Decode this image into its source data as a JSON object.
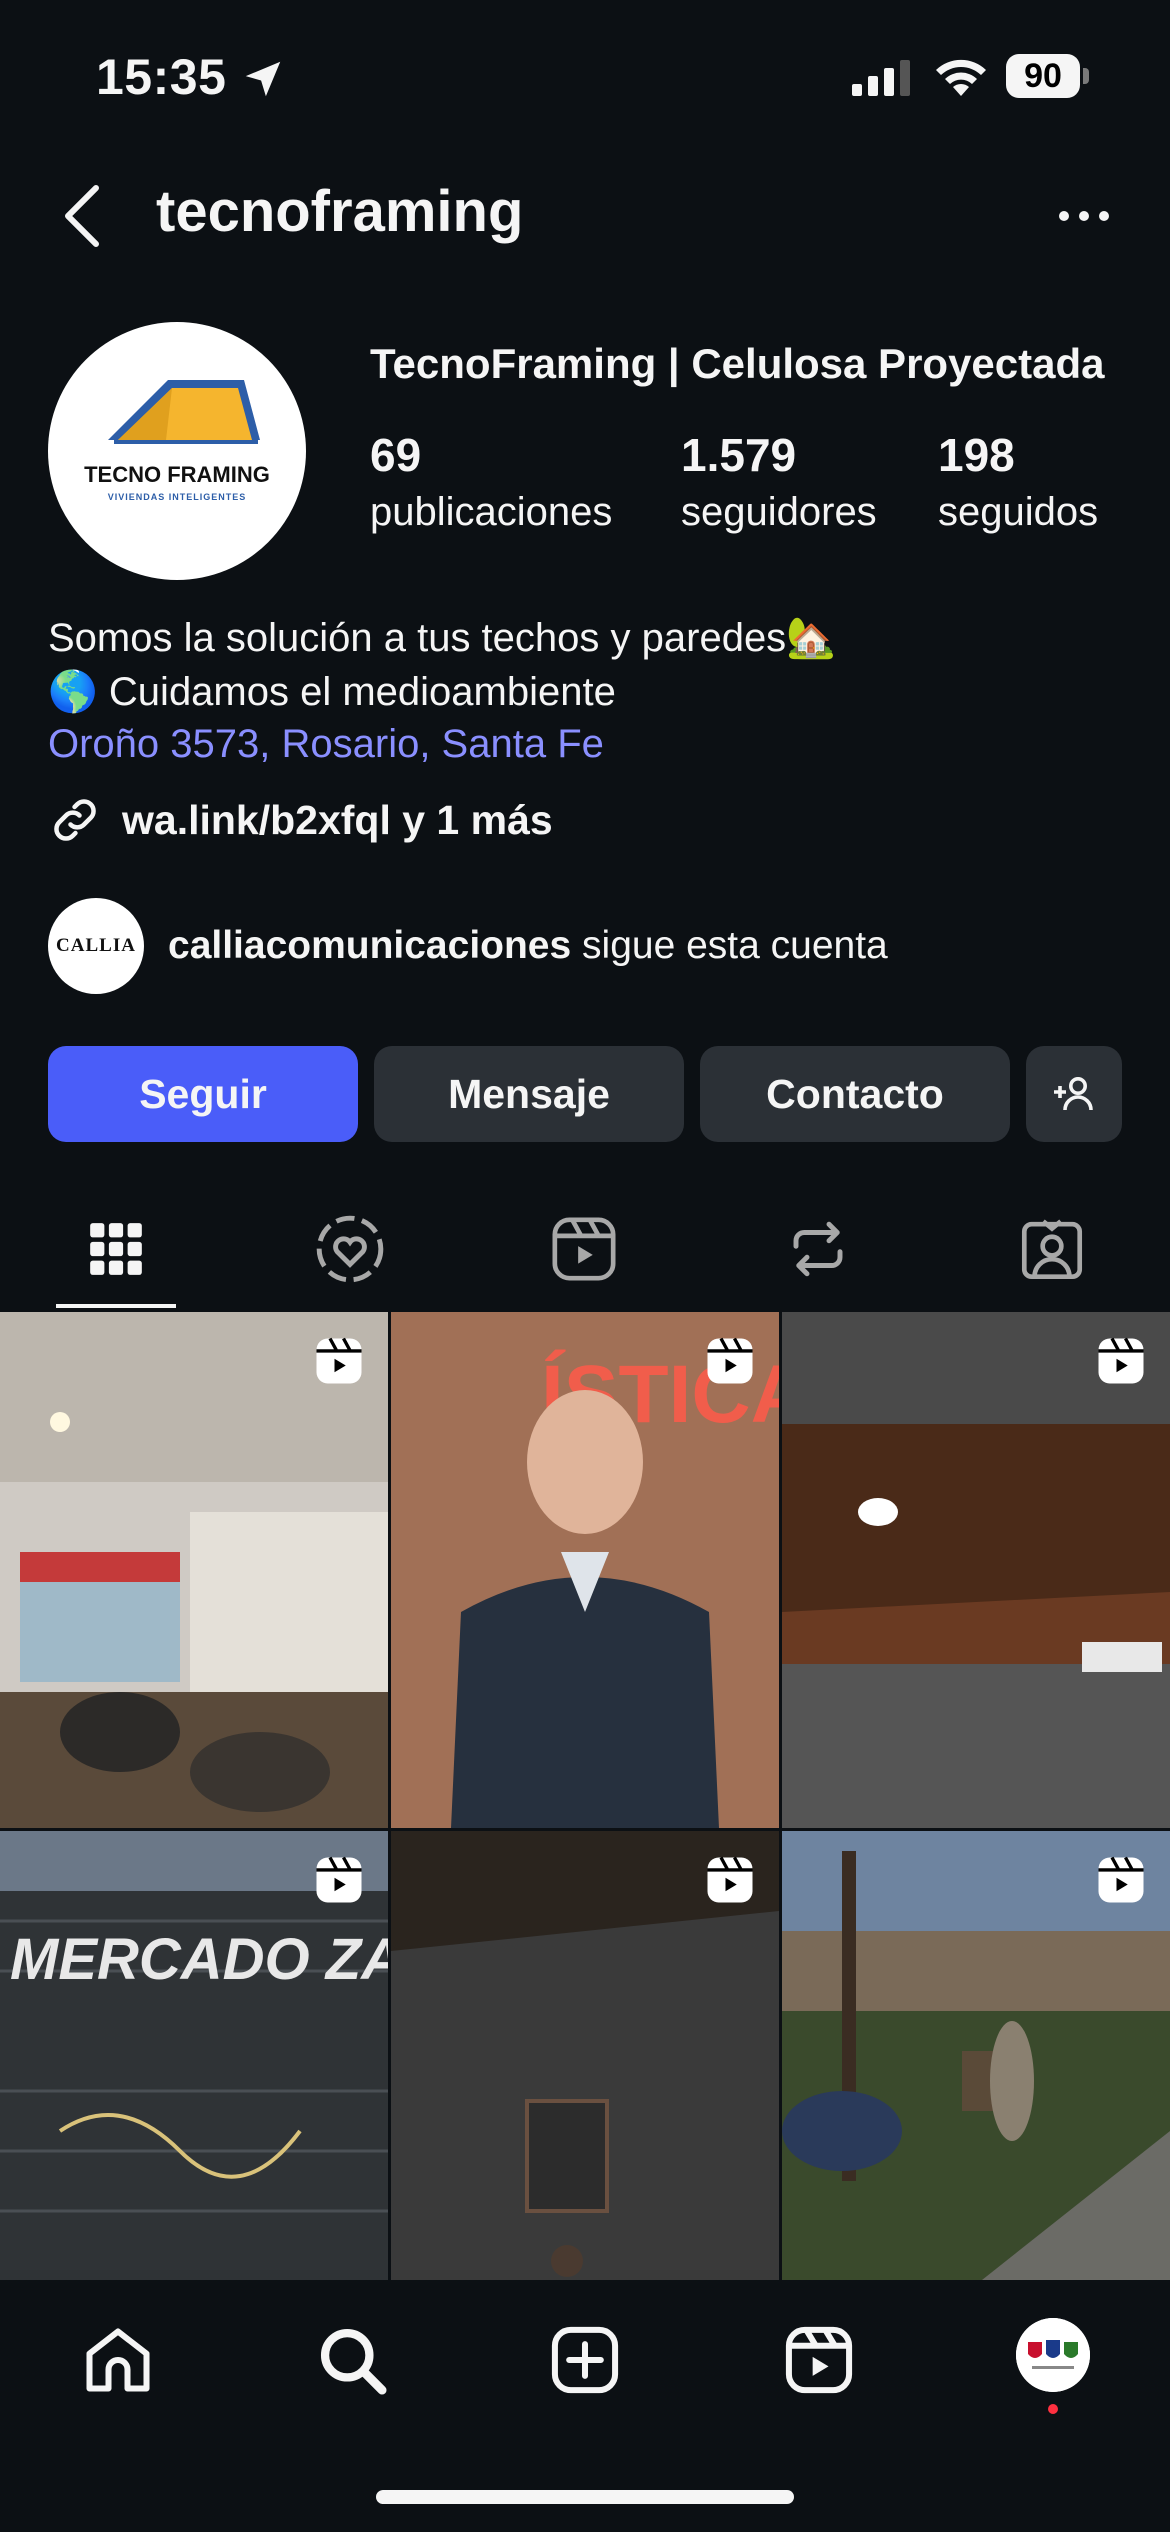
{
  "status_bar": {
    "time": "15:35",
    "battery": "90"
  },
  "header": {
    "username": "tecnoframing"
  },
  "profile": {
    "display_name": "TecnoFraming | Celulosa Proyectada",
    "avatar_logo_text": "TECNO FRAMING",
    "avatar_logo_sub": "VIVIENDAS INTELIGENTES",
    "stats": [
      {
        "value": "69",
        "label": "publicaciones"
      },
      {
        "value": "1.579",
        "label": "seguidores"
      },
      {
        "value": "198",
        "label": "seguidos"
      }
    ],
    "bio_line1": "Somos la solución a tus techos y paredes🏡",
    "bio_line2": "🌎 Cuidamos el medioambiente",
    "location": "Oroño 3573, Rosario, Santa Fe",
    "link": "wa.link/b2xfql y 1 más",
    "followed_by": {
      "avatar_text": "CALLIA",
      "name": "calliacomunicaciones",
      "suffix": " sigue esta cuenta"
    }
  },
  "buttons": {
    "follow": "Seguir",
    "message": "Mensaje",
    "contact": "Contacto"
  },
  "tabs": [
    "grid-icon",
    "collab-icon",
    "reels-icon",
    "reposts-icon",
    "tagged-icon"
  ],
  "grid_posts": [
    {
      "id": "cafe-interior",
      "overlay_text": ""
    },
    {
      "id": "man-speaking",
      "overlay_text": "ÍSTICA"
    },
    {
      "id": "ceiling-wood",
      "overlay_text": ""
    },
    {
      "id": "mercado-sign",
      "overlay_text": "MERCADO ZARPADO"
    },
    {
      "id": "dark-wall",
      "overlay_text": ""
    },
    {
      "id": "yard-worker",
      "overlay_text": ""
    }
  ],
  "bottom_nav": [
    "home-icon",
    "search-icon",
    "create-icon",
    "reels-icon",
    "profile-avatar"
  ],
  "colors": {
    "background": "#0c1014",
    "primary_button": "#4a5df9",
    "secondary_button": "#2b3036",
    "link": "#8a8fff"
  }
}
